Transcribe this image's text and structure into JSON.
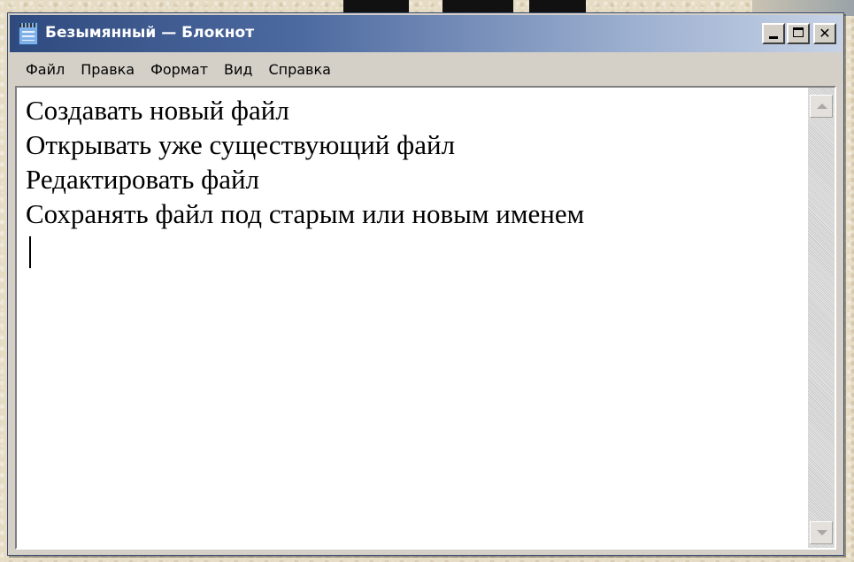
{
  "window": {
    "title": "Безымянный — Блокнот",
    "icon": "notepad-icon"
  },
  "title_buttons": {
    "minimize_icon": "minimize-icon",
    "maximize_icon": "maximize-icon",
    "close_icon": "close-icon"
  },
  "menu": {
    "items": [
      {
        "label": "Файл"
      },
      {
        "label": "Правка"
      },
      {
        "label": "Формат"
      },
      {
        "label": "Вид"
      },
      {
        "label": "Справка"
      }
    ]
  },
  "editor": {
    "lines": [
      "Создавать новый файл",
      "Открывать уже существующий файл",
      "Редактировать файл",
      "Сохранять файл под старым или новым именем"
    ]
  },
  "colors": {
    "titlebar_start": "#2f4a7e",
    "titlebar_end": "#c6d2e6",
    "chrome": "#d4d0c8",
    "editor_background": "#ffffff"
  }
}
